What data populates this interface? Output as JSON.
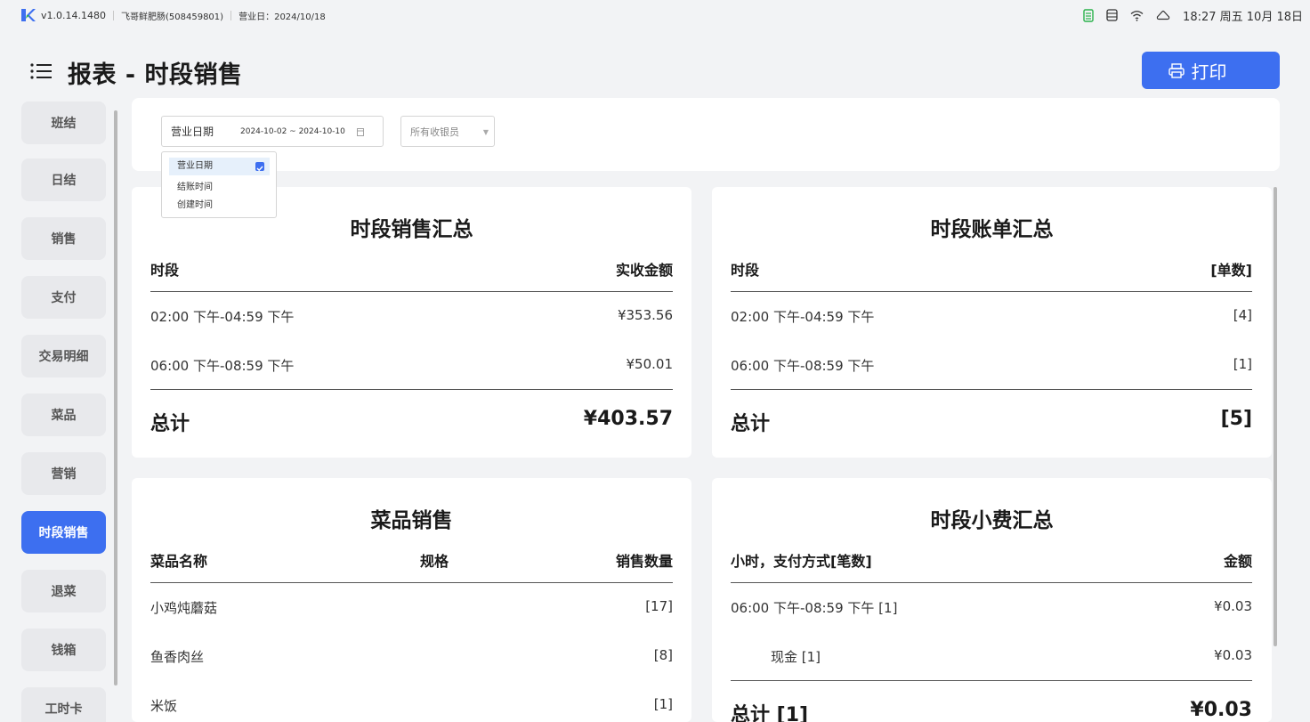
{
  "statusbar": {
    "version": "v1.0.14.1480",
    "store": "飞哥鲜肥肠(508459801)",
    "business_day": "营业日：2024/10/18",
    "time": "18:27 周五 10月 18日"
  },
  "header": {
    "title": "报表 - 时段销售",
    "print_label": "打印"
  },
  "sidebar": {
    "items": [
      {
        "label": "班结"
      },
      {
        "label": "日结"
      },
      {
        "label": "销售"
      },
      {
        "label": "支付"
      },
      {
        "label": "交易明细"
      },
      {
        "label": "菜品"
      },
      {
        "label": "营销"
      },
      {
        "label": "时段销售"
      },
      {
        "label": "退菜"
      },
      {
        "label": "钱箱"
      },
      {
        "label": "工时卡"
      }
    ]
  },
  "filters": {
    "date_type": "营业日期",
    "date_range": "2024-10-02 ~ 2024-10-10",
    "cashier": "所有收银员",
    "date_type_options": [
      "营业日期",
      "结账时间",
      "创建时间"
    ]
  },
  "sales_summary": {
    "title": "时段销售汇总",
    "col_period": "时段",
    "col_amount": "实收金额",
    "rows": [
      {
        "period": "02:00 下午-04:59 下午",
        "amount": "¥353.56"
      },
      {
        "period": "06:00 下午-08:59 下午",
        "amount": "¥50.01"
      }
    ],
    "total_label": "总计",
    "total_value": "¥403.57"
  },
  "bill_summary": {
    "title": "时段账单汇总",
    "col_period": "时段",
    "col_count": "[单数]",
    "rows": [
      {
        "period": "02:00 下午-04:59 下午",
        "count": "[4]"
      },
      {
        "period": "06:00 下午-08:59 下午",
        "count": "[1]"
      }
    ],
    "total_label": "总计",
    "total_value": "[5]"
  },
  "dish_sales": {
    "title": "菜品销售",
    "col_name": "菜品名称",
    "col_spec": "规格",
    "col_qty": "销售数量",
    "rows": [
      {
        "name": "小鸡炖蘑菇",
        "qty": "[17]"
      },
      {
        "name": "鱼香肉丝",
        "qty": "[8]"
      },
      {
        "name": "米饭",
        "qty": "[1]"
      }
    ]
  },
  "tip_summary": {
    "title": "时段小费汇总",
    "col_hour": "小时，支付方式[笔数]",
    "col_amount": "金额",
    "rows": [
      {
        "label": "06:00 下午-08:59 下午 [1]",
        "amount": "¥0.03"
      },
      {
        "label": "现金 [1]",
        "amount": "¥0.03"
      }
    ],
    "total_label": "总计 [1]",
    "total_value": "¥0.03"
  },
  "colors": {
    "accent": "#3d6ff0",
    "battery": "#2bb24c"
  }
}
